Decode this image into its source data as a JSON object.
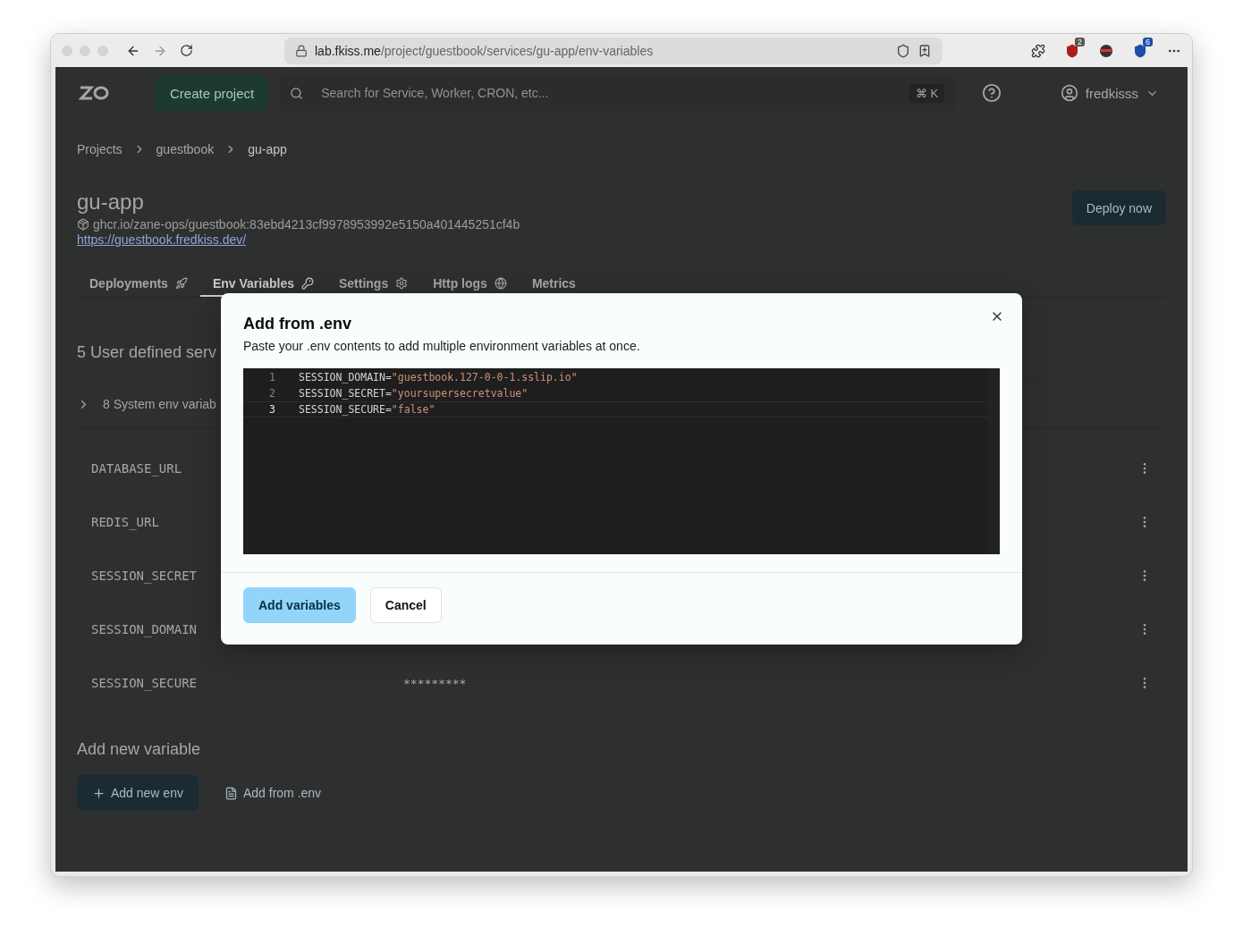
{
  "browser": {
    "url_host": "lab.fkiss.me",
    "url_path": "/project/guestbook/services/gu-app/env-variables",
    "extensions": [
      {
        "kind": "puzzle"
      },
      {
        "kind": "shield",
        "badge": "2"
      },
      {
        "kind": "ninja"
      },
      {
        "kind": "vault",
        "badge": "6"
      }
    ]
  },
  "navbar": {
    "create_button": "Create project",
    "search": {
      "placeholder": "Search for Service, Worker, CRON, etc..."
    },
    "shortcut": "⌘ K",
    "user": "fredkisss"
  },
  "breadcrumbs": [
    "Projects",
    "guestbook",
    "gu-app"
  ],
  "service": {
    "title": "gu-app",
    "image": "ghcr.io/zane-ops/guestbook:83ebd4213cf9978953992e5150a401445251cf4b",
    "url": "https://guestbook.fredkiss.dev/",
    "deploy_button": "Deploy now"
  },
  "tabs": [
    {
      "label": "Deployments",
      "selected": false
    },
    {
      "label": "Env Variables",
      "selected": true
    },
    {
      "label": "Settings",
      "selected": false
    },
    {
      "label": "Http logs",
      "selected": false
    },
    {
      "label": "Metrics",
      "selected": false
    }
  ],
  "section_title": "5 User defined serv",
  "system_env": {
    "label": "8 System env variab",
    "expanded": false
  },
  "variables": [
    {
      "name": "DATABASE_URL"
    },
    {
      "name": "REDIS_URL"
    },
    {
      "name": "SESSION_SECRET"
    },
    {
      "name": "SESSION_DOMAIN"
    },
    {
      "name": "SESSION_SECURE",
      "value": "*********"
    }
  ],
  "add_section": {
    "title": "Add new variable",
    "buttons": [
      {
        "kind": "primary",
        "label": "Add new env"
      },
      {
        "kind": "secondary",
        "label": "Add from .env"
      }
    ]
  },
  "modal": {
    "title": "Add from .env",
    "description": "Paste your .env contents to add multiple environment variables at once.",
    "lines": [
      {
        "number": "1",
        "key": "SESSION_DOMAIN=",
        "value": "\"guestbook.127-0-0-1.sslip.io\"",
        "active": false
      },
      {
        "number": "2",
        "key": "SESSION_SECRET=",
        "value": "\"yoursupersecretvalue\"",
        "active": false
      },
      {
        "number": "3",
        "key": "SESSION_SECURE=",
        "value": "\"false\"",
        "active": true
      }
    ],
    "buttons": [
      {
        "kind": "primary",
        "label": "Add variables"
      },
      {
        "kind": "secondary",
        "label": "Cancel"
      }
    ]
  }
}
